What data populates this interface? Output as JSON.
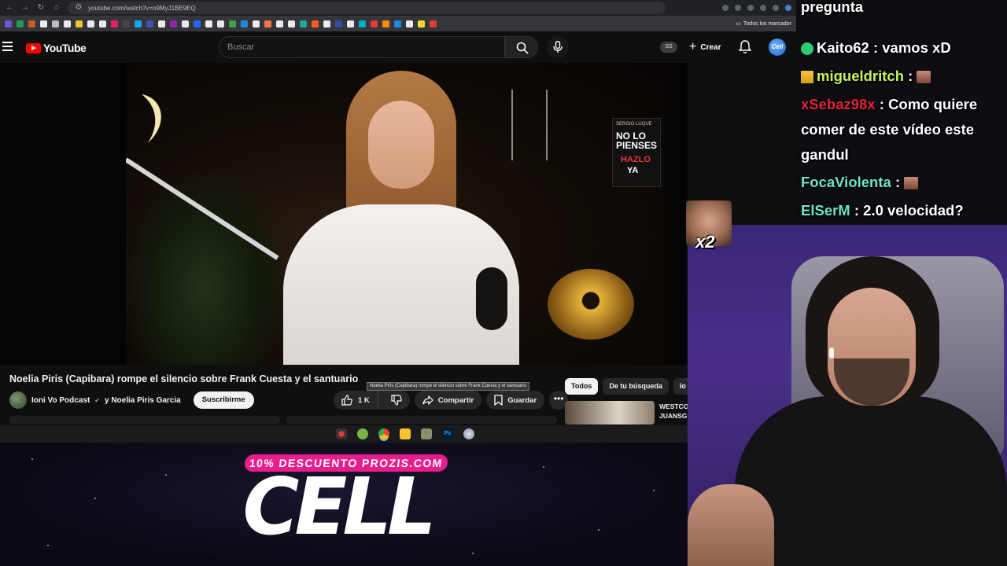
{
  "browser": {
    "url": "youtube.com/watch?v=o9MyJ1BE9EQ",
    "bookmarks_all_label": "Todos los marcador"
  },
  "youtube": {
    "logo_text": "YouTube",
    "search_placeholder": "Buscar",
    "ss_badge": "SS",
    "create_label": "Crear",
    "avatar_text": "Cell"
  },
  "video": {
    "title": "Noelia Piris (Capibara) rompe el silencio sobre Frank Cuesta y el santuario",
    "tooltip": "Noelia Piris (Capibara) rompe el silencio sobre Frank Cuesta y el santuario",
    "book_author": "SERGIO LUQUE",
    "book_title_line1": "NO LO",
    "book_title_line2": "PIENSES",
    "book_title_line3": "HAZLO",
    "book_title_line4": "YA"
  },
  "channel": {
    "name": "Ioni Vo Podcast",
    "collab": "y Noelia Piris Garcia",
    "subscribe_label": "Suscribirme"
  },
  "actions": {
    "like_count": "1 K",
    "share_label": "Compartir",
    "save_label": "Guardar",
    "more_label": "•••"
  },
  "sidebar": {
    "chips": [
      "Todos",
      "De tu búsqueda",
      "Io"
    ],
    "rec_title_line1": "WESTCO",
    "rec_title_line2": "JUANSG"
  },
  "chat": {
    "messages": [
      {
        "user": "",
        "text": "pregunta",
        "user_color": "#ffffff"
      },
      {
        "user": "Kaito62",
        "text": ": vamos xD",
        "user_color": "#ffffff"
      },
      {
        "user": "migueldritch",
        "text": ":",
        "user_color": "#c6f55a"
      },
      {
        "user": "xSebaz98x",
        "text": ": Como quiere",
        "user_color": "#e0253a"
      },
      {
        "user": "",
        "text": "comer de este vídeo este",
        "user_color": "#ffffff"
      },
      {
        "user": "",
        "text": "gandul",
        "user_color": "#ffffff"
      },
      {
        "user": "FocaViolenta",
        "text": ":",
        "user_color": "#6ee6c8"
      },
      {
        "user": "ElSerM",
        "text": ": 2.0 velocidad?",
        "user_color": "#6ee6c8"
      }
    ]
  },
  "overlay": {
    "x2_label": "x2"
  },
  "promo": {
    "code_text": "10% DESCUENTO PROZIS.COM",
    "logo_text": "CELL",
    "brand_color": "#e91e8c"
  }
}
